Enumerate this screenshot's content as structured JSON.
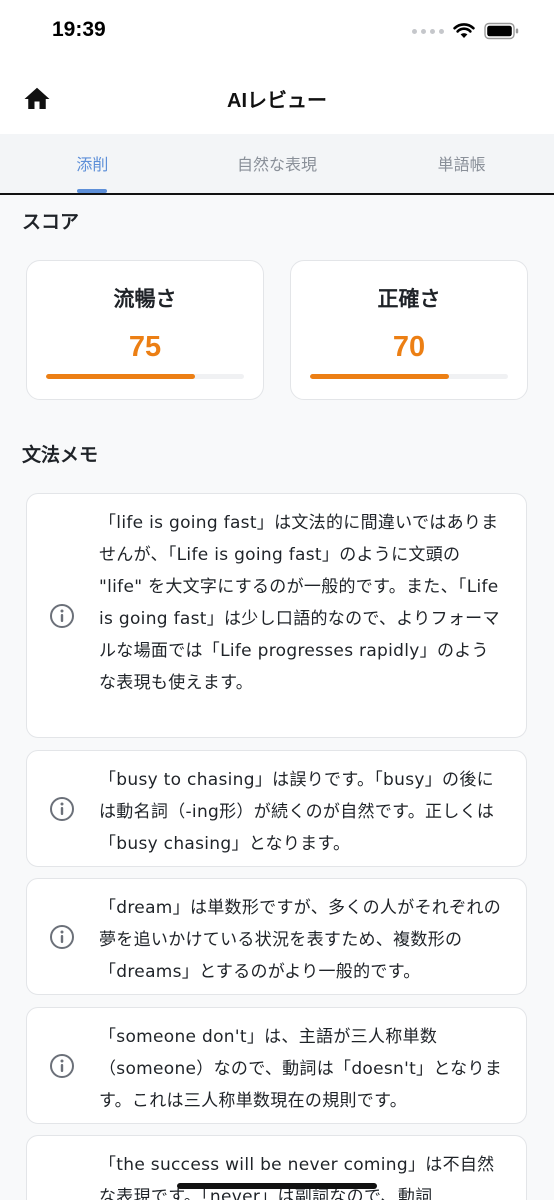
{
  "status_bar": {
    "time": "19:39"
  },
  "nav": {
    "title": "AIレビュー"
  },
  "tabs": [
    {
      "label": "添削",
      "active": true
    },
    {
      "label": "自然な表現",
      "active": false
    },
    {
      "label": "単語帳",
      "active": false
    }
  ],
  "score": {
    "section_title": "スコア",
    "items": [
      {
        "label": "流暢さ",
        "value": "75",
        "fill_percent": 75
      },
      {
        "label": "正確さ",
        "value": "70",
        "fill_percent": 70
      }
    ]
  },
  "grammar": {
    "section_title": "文法メモ",
    "notes": [
      {
        "text": "「life is going fast」は文法的に間違いではありませんが、「Life is going fast」のように文頭の \"life\" を大文字にするのが一般的です。また、「Life is going fast」は少し口語的なので、よりフォーマルな場面では「Life progresses rapidly」のような表現も使えます。"
      },
      {
        "text": "「busy to chasing」は誤りです。「busy」の後には動名詞（-ing形）が続くのが自然です。正しくは「busy chasing」となります。"
      },
      {
        "text": "「dream」は単数形ですが、多くの人がそれぞれの夢を追いかけている状況を表すため、複数形の「dreams」とするのがより一般的です。"
      },
      {
        "text": "「someone don't」は、主語が三人称単数（someone）なので、動詞は「doesn't」となります。これは三人称単数現在の規則です。"
      },
      {
        "text": "「the success will be never coming」は不自然な表現です。「never」は副詞なので、動詞"
      }
    ]
  },
  "colors": {
    "accent": "#ec7f14",
    "tab_active": "#5d8fd8"
  },
  "icons": {
    "home": "home-icon",
    "info": "info-icon"
  }
}
